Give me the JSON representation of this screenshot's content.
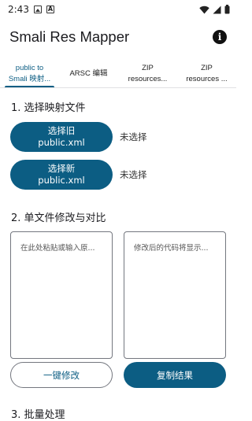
{
  "status_bar": {
    "time": "2:43"
  },
  "app_bar": {
    "title": "Smali Res Mapper",
    "info_icon": "info-icon"
  },
  "tabs": [
    {
      "line1": "public to",
      "line2": "Smali 映射..."
    },
    {
      "line1": "ARSC 编辑",
      "line2": ""
    },
    {
      "line1": "ZIP",
      "line2": "resources..."
    },
    {
      "line1": "ZIP",
      "line2": "resources ..."
    }
  ],
  "section1": {
    "title": "1. 选择映射文件",
    "old_button": {
      "line1": "选择旧",
      "line2": "public.xml"
    },
    "old_status": "未选择",
    "new_button": {
      "line1": "选择新",
      "line2": "public.xml"
    },
    "new_status": "未选择"
  },
  "section2": {
    "title": "2. 单文件修改与对比",
    "input_placeholder": "在此处粘贴或输入原...",
    "output_placeholder": "修改后的代码将显示...",
    "modify_button": "一键修改",
    "copy_button": "复制结果"
  },
  "section3": {
    "title": "3. 批量处理"
  },
  "colors": {
    "primary": "#0c5d83",
    "outline": "#74777f"
  }
}
